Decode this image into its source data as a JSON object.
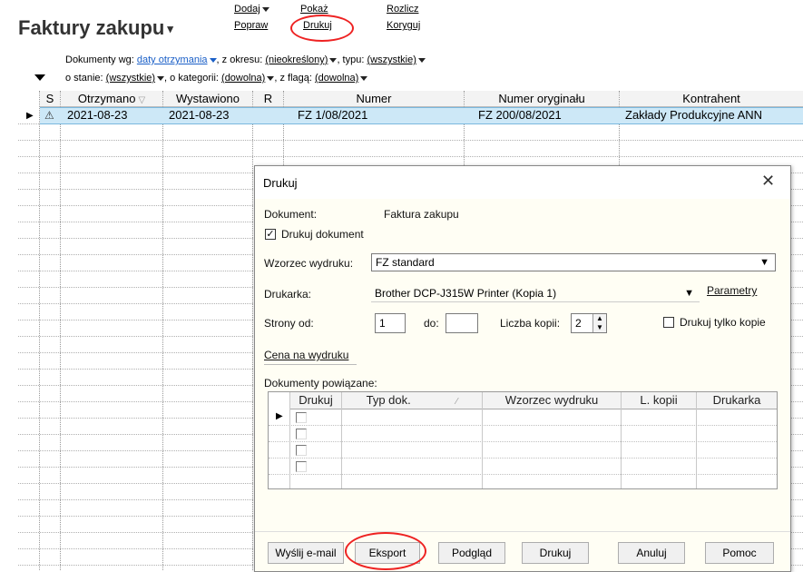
{
  "page": {
    "title": "Faktury zakupu",
    "menu": {
      "dodaj": "Dodaj",
      "popraw": "Popraw",
      "pokaz": "Pokaż",
      "drukuj": "Drukuj",
      "rozlicz": "Rozlicz",
      "koryguj": "Koryguj"
    }
  },
  "filters": {
    "line1": {
      "label_docs": "Dokumenty wg:",
      "docs_value": "daty otrzymania",
      "label_period": ", z okresu:",
      "period_value": "(nieokreślony)",
      "label_type": ", typu:",
      "type_value": "(wszystkie)"
    },
    "line2": {
      "label_state": "o stanie:",
      "state_value": "(wszystkie)",
      "label_category": ", o kategorii:",
      "category_value": "(dowolna)",
      "label_flag": ", z flagą:",
      "flag_value": "(dowolna)"
    }
  },
  "grid": {
    "columns": [
      "S",
      "Otrzymano",
      "Wystawiono",
      "R",
      "Numer",
      "Numer oryginału",
      "Kontrahent"
    ],
    "rows": [
      {
        "status_icon": "warning-icon",
        "otrzymano": "2021-08-23",
        "wystawiono": "2021-08-23",
        "r": "",
        "numer": "FZ 1/08/2021",
        "numer_oryginalu": "FZ 200/08/2021",
        "kontrahent": "Zakłady Produkcyjne ANN"
      }
    ]
  },
  "dialog": {
    "title": "Drukuj",
    "dokument_label": "Dokument:",
    "dokument_value": "Faktura zakupu",
    "drukuj_dokument_label": "Drukuj dokument",
    "drukuj_dokument_checked": true,
    "wzorzec_label": "Wzorzec wydruku:",
    "wzorzec_value": "FZ standard",
    "drukarka_label": "Drukarka:",
    "drukarka_value": "Brother DCP-J315W Printer (Kopia 1)",
    "parametry_link": "Parametry",
    "strony_od_label": "Strony od:",
    "strony_od_value": "1",
    "do_label": "do:",
    "do_value": "",
    "liczba_kopii_label": "Liczba kopii:",
    "liczba_kopii_value": "2",
    "tylko_kopie_label": "Drukuj tylko kopie",
    "tylko_kopie_checked": false,
    "cena_link": "Cena na wydruku",
    "powiazane_label": "Dokumenty powiązane:",
    "sub_columns": [
      "Drukuj",
      "Typ dok.",
      "Wzorzec wydruku",
      "L. kopii",
      "Drukarka"
    ],
    "buttons": {
      "email": "Wyślij e-mail",
      "eksport": "Eksport",
      "podglad": "Podgląd",
      "drukuj": "Drukuj",
      "anuluj": "Anuluj",
      "pomoc": "Pomoc"
    }
  },
  "colors": {
    "selection": "#cde8f7",
    "link_blue": "#1a5fc7",
    "highlight_red": "#e22222",
    "dialog_bg": "#fffef4"
  }
}
